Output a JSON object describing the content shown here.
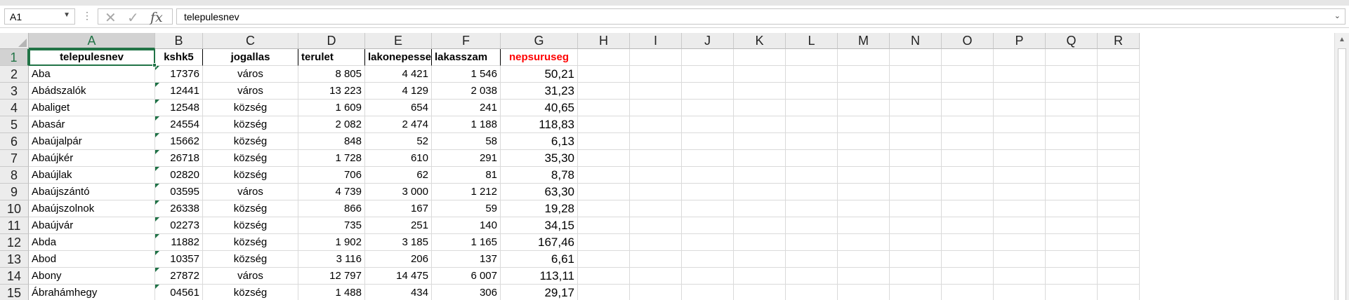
{
  "formula_bar": {
    "name_box": "A1",
    "formula": "telepulesnev"
  },
  "columns": [
    "A",
    "B",
    "C",
    "D",
    "E",
    "F",
    "G",
    "H",
    "I",
    "J",
    "K",
    "L",
    "M",
    "N",
    "O",
    "P",
    "Q",
    "R"
  ],
  "rows": [
    "1",
    "2",
    "3",
    "4",
    "5",
    "6",
    "7",
    "8",
    "9",
    "10",
    "11",
    "12",
    "13",
    "14",
    "15"
  ],
  "header": [
    "telepulesnev",
    "kshk5",
    "jogallas",
    "terulet",
    "lakonepesseg",
    "lakasszam",
    "nepsuruseg"
  ],
  "data": [
    [
      "Aba",
      "17376",
      "város",
      "8 805",
      "4 421",
      "1 546",
      "50,21"
    ],
    [
      "Abádszalók",
      "12441",
      "város",
      "13 223",
      "4 129",
      "2 038",
      "31,23"
    ],
    [
      "Abaliget",
      "12548",
      "község",
      "1 609",
      "654",
      "241",
      "40,65"
    ],
    [
      "Abasár",
      "24554",
      "község",
      "2 082",
      "2 474",
      "1 188",
      "118,83"
    ],
    [
      "Abaújalpár",
      "15662",
      "község",
      "848",
      "52",
      "58",
      "6,13"
    ],
    [
      "Abaújkér",
      "26718",
      "község",
      "1 728",
      "610",
      "291",
      "35,30"
    ],
    [
      "Abaújlak",
      "02820",
      "község",
      "706",
      "62",
      "81",
      "8,78"
    ],
    [
      "Abaújszántó",
      "03595",
      "város",
      "4 739",
      "3 000",
      "1 212",
      "63,30"
    ],
    [
      "Abaújszolnok",
      "26338",
      "község",
      "866",
      "167",
      "59",
      "19,28"
    ],
    [
      "Abaújvár",
      "02273",
      "község",
      "735",
      "251",
      "140",
      "34,15"
    ],
    [
      "Abda",
      "11882",
      "község",
      "1 902",
      "3 185",
      "1 165",
      "167,46"
    ],
    [
      "Abod",
      "10357",
      "község",
      "3 116",
      "206",
      "137",
      "6,61"
    ],
    [
      "Abony",
      "27872",
      "város",
      "12 797",
      "14 475",
      "6 007",
      "113,11"
    ],
    [
      "Ábrahámhegy",
      "04561",
      "község",
      "1 488",
      "434",
      "306",
      "29,17"
    ]
  ],
  "colors": {
    "accent": "#217346",
    "header_red": "#ff0000"
  }
}
